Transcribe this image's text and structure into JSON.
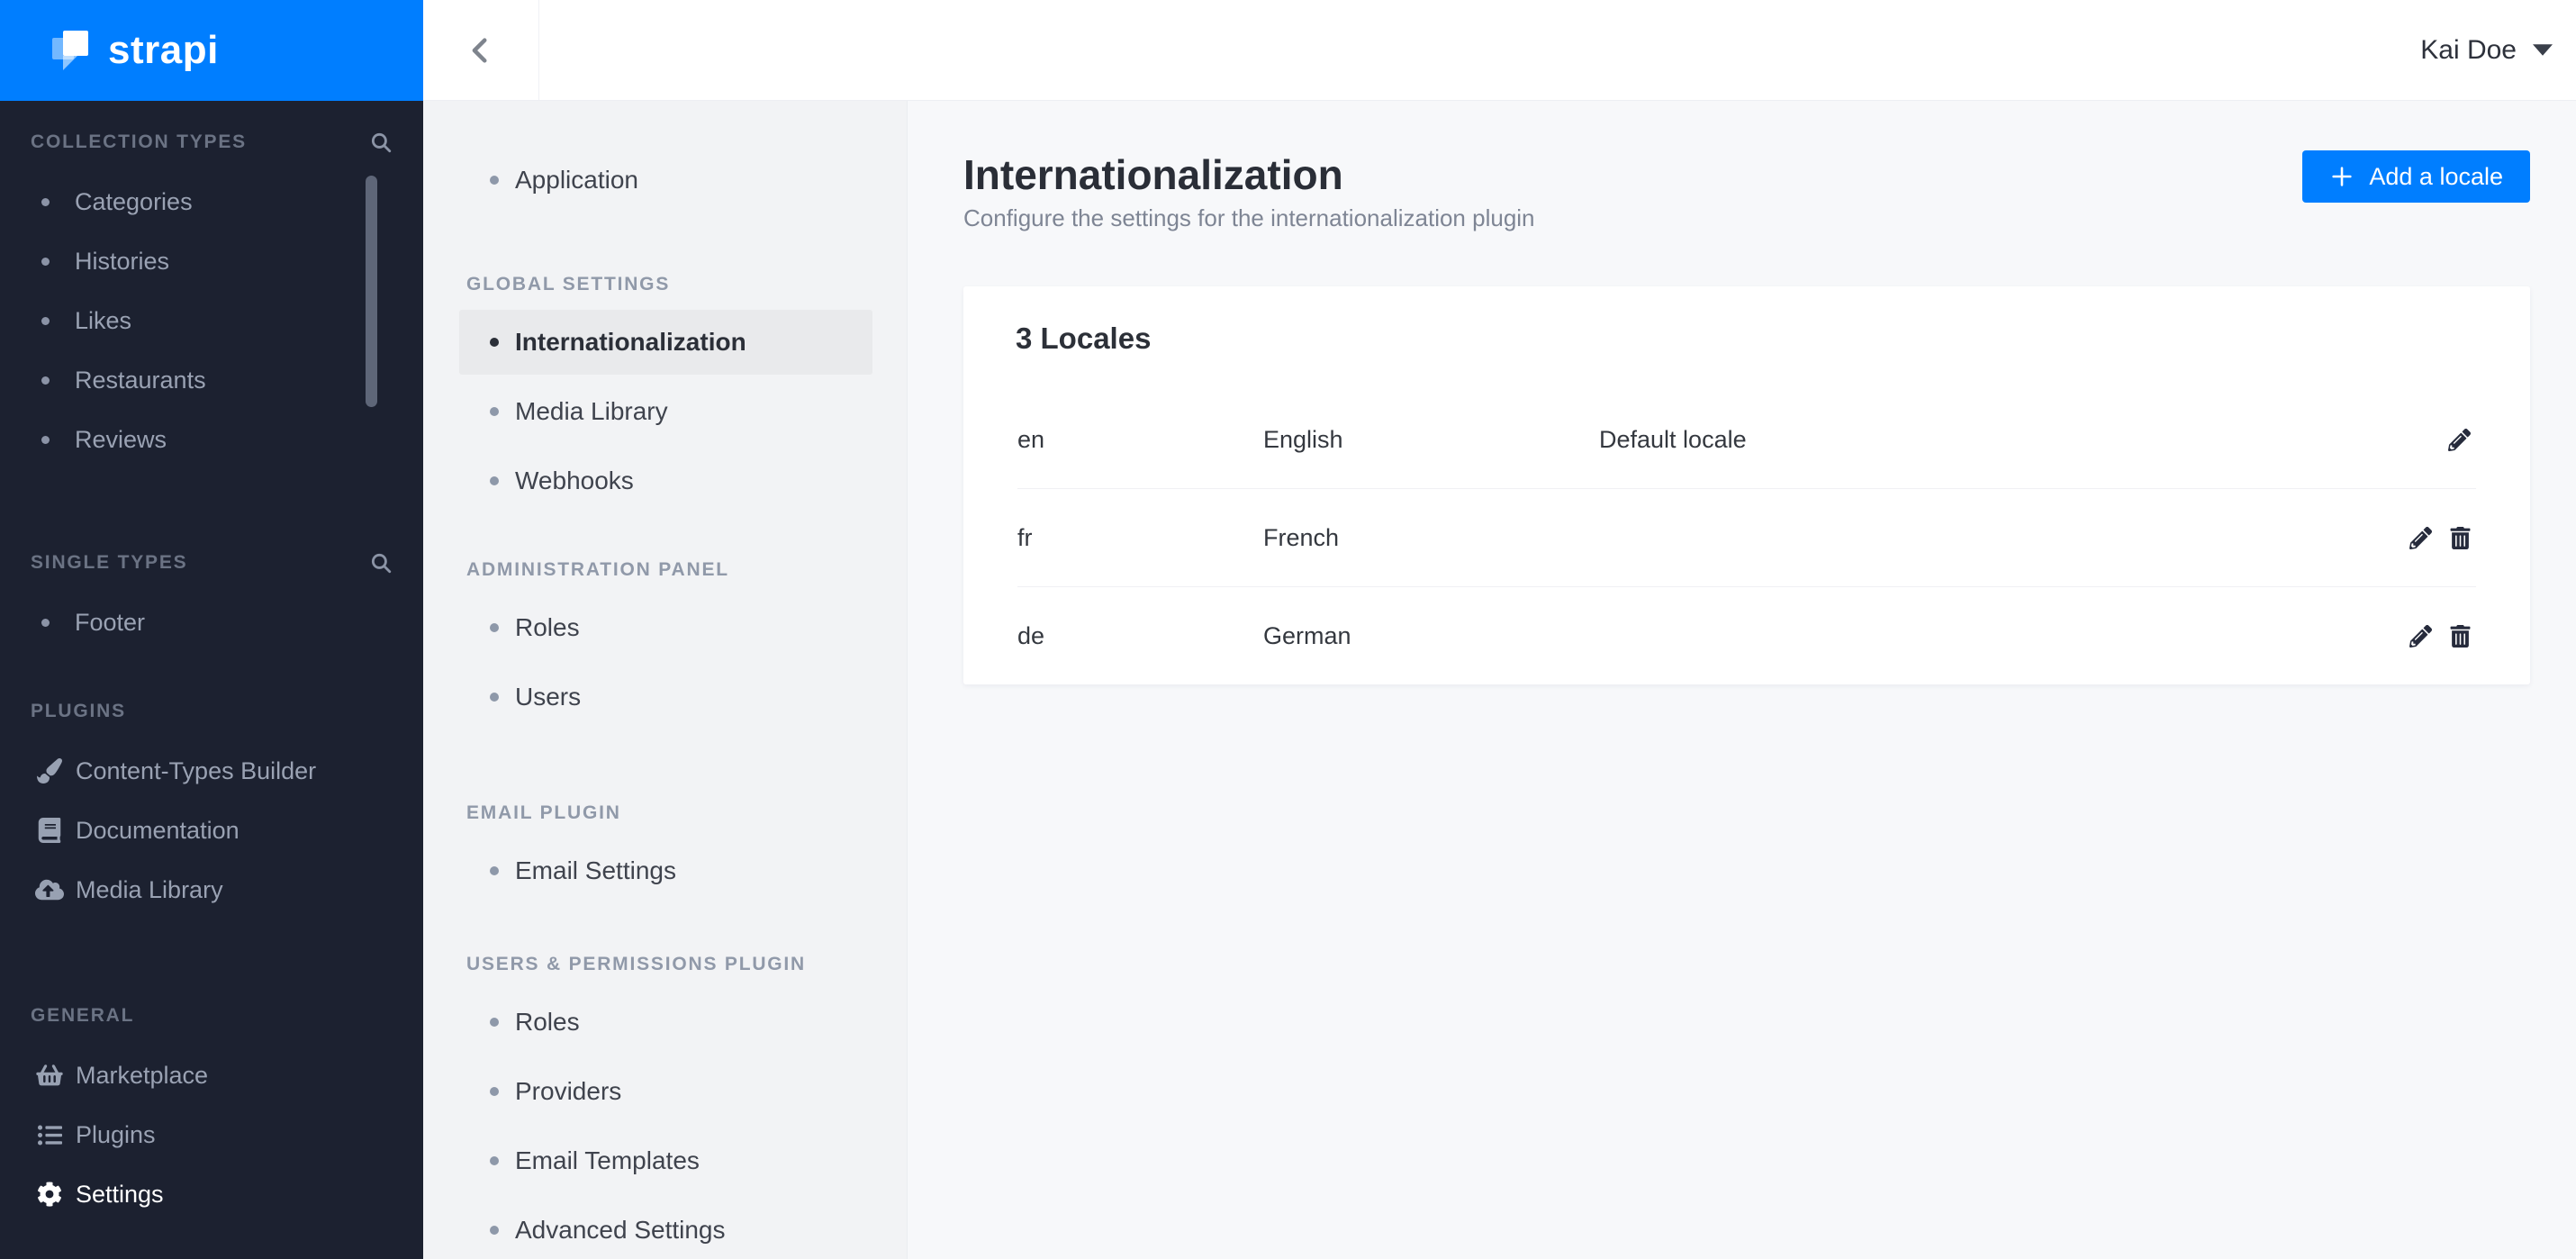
{
  "colors": {
    "accent_blue": "#007eff",
    "sidebar_dark": "#1c2130",
    "settings_sidebar_bg": "#f2f3f5",
    "active_item_bg": "#e9eaec"
  },
  "brand": {
    "logo_text": "strapi"
  },
  "topbar": {
    "user_name": "Kai Doe"
  },
  "nav": {
    "sections": [
      {
        "title": "COLLECTION TYPES",
        "items": [
          "Categories",
          "Histories",
          "Likes",
          "Restaurants",
          "Reviews"
        ]
      },
      {
        "title": "SINGLE TYPES",
        "items": [
          "Footer"
        ]
      },
      {
        "title": "PLUGINS",
        "items": [
          "Content-Types Builder",
          "Documentation",
          "Media Library"
        ]
      },
      {
        "title": "GENERAL",
        "items": [
          "Marketplace",
          "Plugins",
          "Settings"
        ]
      }
    ],
    "active_item": "Settings"
  },
  "settings_nav": {
    "standalone": [
      "Application"
    ],
    "sections": [
      {
        "title": "GLOBAL SETTINGS",
        "items": [
          "Internationalization",
          "Media Library",
          "Webhooks"
        ]
      },
      {
        "title": "ADMINISTRATION PANEL",
        "items": [
          "Roles",
          "Users"
        ]
      },
      {
        "title": "EMAIL PLUGIN",
        "items": [
          "Email Settings"
        ]
      },
      {
        "title": "USERS & PERMISSIONS PLUGIN",
        "items": [
          "Roles",
          "Providers",
          "Email Templates",
          "Advanced Settings"
        ]
      }
    ],
    "active_item": "Internationalization"
  },
  "page": {
    "title": "Internationalization",
    "subtitle": "Configure the settings for the internationalization plugin",
    "add_locale_label": "Add a locale"
  },
  "locales": {
    "card_title": "3 Locales",
    "rows": [
      {
        "code": "en",
        "name": "English",
        "note": "Default locale"
      },
      {
        "code": "fr",
        "name": "French",
        "note": ""
      },
      {
        "code": "de",
        "name": "German",
        "note": ""
      }
    ]
  }
}
